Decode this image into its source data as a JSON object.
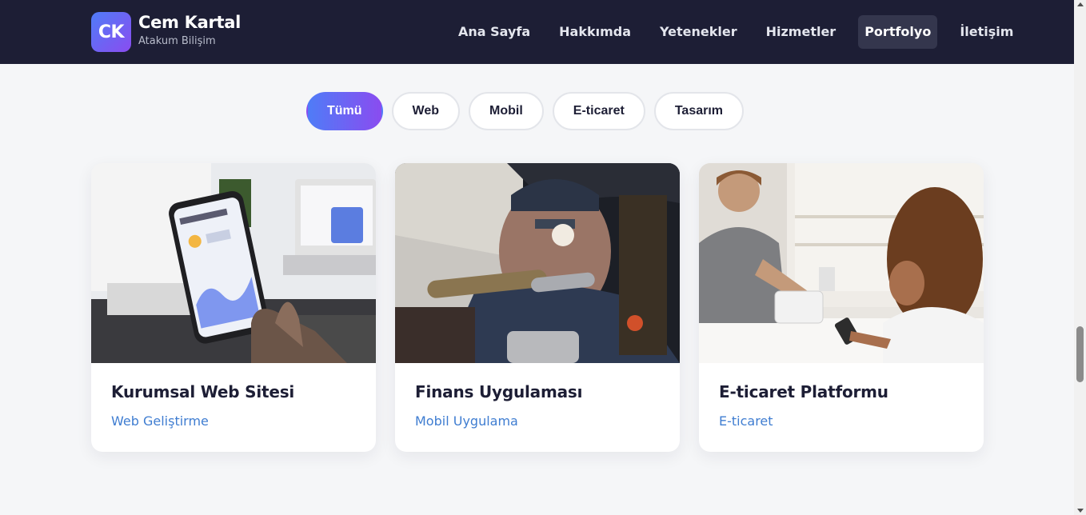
{
  "brand": {
    "logo": "CK",
    "name": "Cem Kartal",
    "subtitle": "Atakum Bilişim"
  },
  "nav": {
    "items": [
      {
        "label": "Ana Sayfa",
        "active": false
      },
      {
        "label": "Hakkımda",
        "active": false
      },
      {
        "label": "Yetenekler",
        "active": false
      },
      {
        "label": "Hizmetler",
        "active": false
      },
      {
        "label": "Portfolyo",
        "active": true
      },
      {
        "label": "İletişim",
        "active": false
      }
    ]
  },
  "filters": [
    {
      "label": "Tümü",
      "active": true
    },
    {
      "label": "Web",
      "active": false
    },
    {
      "label": "Mobil",
      "active": false
    },
    {
      "label": "E-ticaret",
      "active": false
    },
    {
      "label": "Tasarım",
      "active": false
    }
  ],
  "projects": [
    {
      "title": "Kurumsal Web Sitesi",
      "category": "Web Geliştirme",
      "image": "smartphone-weather-app-photo"
    },
    {
      "title": "Finans Uygulaması",
      "category": "Mobil Uygulama",
      "image": "workshop-soldering-photo"
    },
    {
      "title": "E-ticaret Platformu",
      "category": "E-ticaret",
      "image": "shop-checkout-payment-photo"
    }
  ],
  "colors": {
    "header_bg": "#1d1e35",
    "accent_start": "#4f7cf7",
    "accent_end": "#8a4cf0",
    "category_text": "#3f7dd1"
  }
}
